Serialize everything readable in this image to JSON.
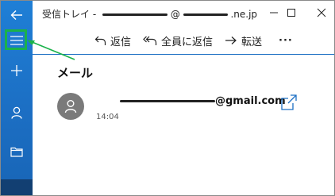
{
  "window": {
    "title_prefix": "受信トレイ -",
    "title_at": "@",
    "title_domain": ".ne.jp"
  },
  "toolbar": {
    "reply": "返信",
    "reply_all": "全員に返信",
    "forward": "転送",
    "more": "···"
  },
  "content": {
    "heading": "メール",
    "sender_domain": "@gmail.com",
    "time": "14:04"
  },
  "colors": {
    "rail": "#1c6fc4",
    "accent": "#1c6fc4",
    "annotation": "#1ab24a"
  },
  "icons": {
    "back": "back-arrow-icon",
    "menu": "hamburger-menu-icon",
    "new": "plus-icon",
    "accounts": "person-icon",
    "folders": "folder-icon",
    "avatar": "person-icon",
    "popout": "open-in-new-window-icon"
  }
}
